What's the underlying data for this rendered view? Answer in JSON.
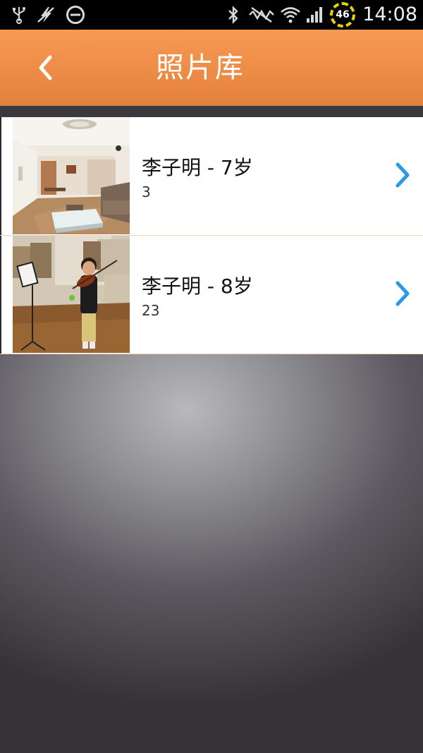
{
  "status_bar": {
    "time": "14:08",
    "battery_level": "46",
    "icons": [
      "usb-icon",
      "flash-off-icon",
      "do-not-disturb-icon",
      "bluetooth-icon",
      "mute-icon",
      "wifi-icon",
      "signal-icon",
      "battery-icon"
    ]
  },
  "header": {
    "title": "照片库",
    "back_icon": "chevron-left-icon",
    "background": "#f08c47"
  },
  "albums": [
    {
      "name": "李子明 - 7岁",
      "count": "3",
      "thumbnail": "living-room-photo"
    },
    {
      "name": "李子明 - 8岁",
      "count": "23",
      "thumbnail": "boy-violin-photo"
    }
  ],
  "colors": {
    "accent": "#f08c47",
    "chevron": "#2b9ae6",
    "row_separator": "#f1d2bc"
  }
}
